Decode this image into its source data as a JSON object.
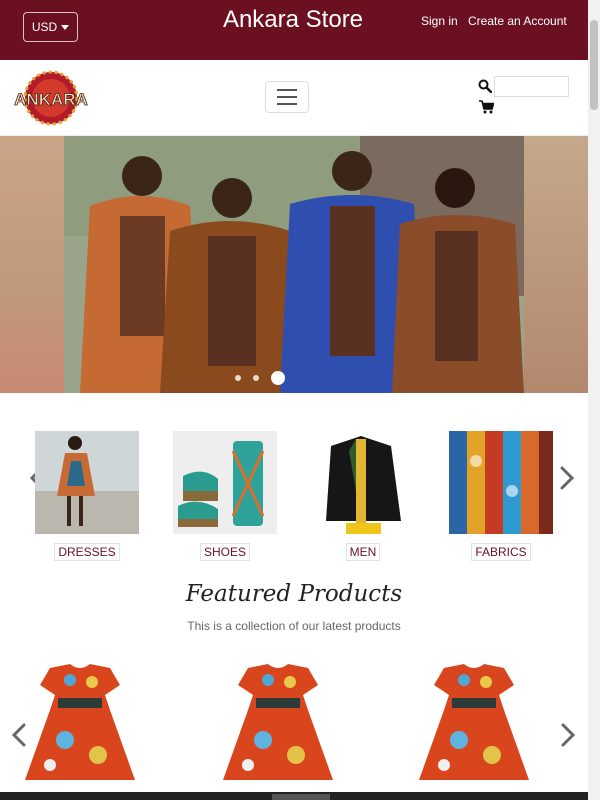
{
  "topbar": {
    "currency": "USD",
    "store_title": "Ankara Store",
    "signin": "Sign in",
    "create_account": "Create an Account"
  },
  "logo": {
    "text": "ANKARA"
  },
  "search": {
    "placeholder": ""
  },
  "hero": {
    "slide_count": 3,
    "active_slide": 3
  },
  "categories": [
    {
      "label": "DRESSES"
    },
    {
      "label": "SHOES"
    },
    {
      "label": "MEN"
    },
    {
      "label": "FABRICS"
    }
  ],
  "featured": {
    "title": "Featured Products",
    "subtitle": "This is a collection of our latest products"
  },
  "colors": {
    "brand": "#6b1021"
  },
  "icons": [
    "caret-down-icon",
    "hamburger-icon",
    "search-icon",
    "cart-icon",
    "chevron-left-icon",
    "chevron-right-icon"
  ]
}
